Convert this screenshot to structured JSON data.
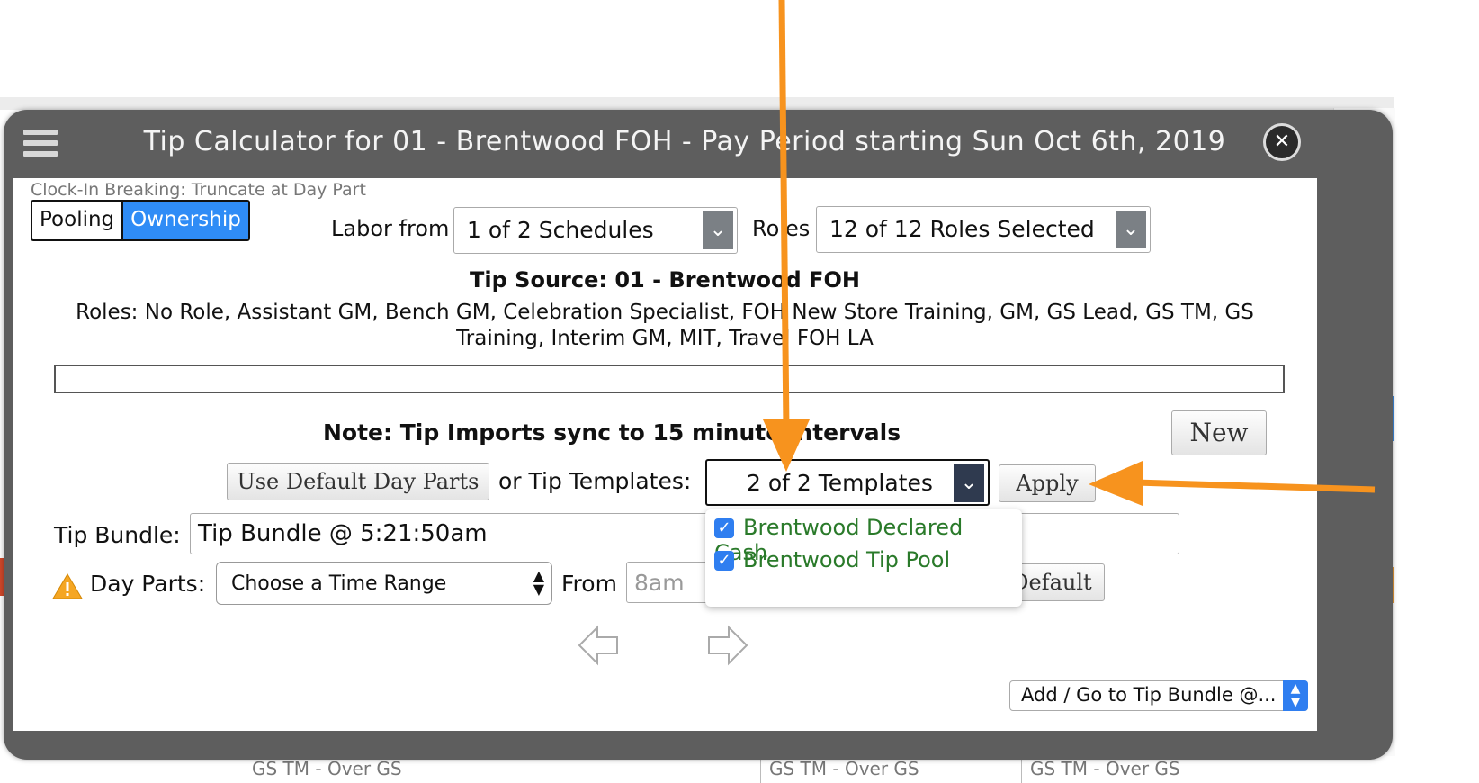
{
  "dialog": {
    "title": "Tip Calculator for 01 - Brentwood FOH - Pay Period starting Sun Oct 6th, 2019",
    "menu_icon": "hamburger-menu-icon",
    "close_icon": "close-circle-icon",
    "clock_in": "Clock-In Breaking: Truncate at Day Part",
    "toggle": {
      "pooling": "Pooling",
      "ownership": "Ownership",
      "active": "Ownership"
    },
    "labor_from_label": "Labor from",
    "labor_from_value": "1 of 2 Schedules",
    "roles_label": "Roles",
    "roles_value": "12 of 12 Roles Selected",
    "tip_source": "Tip Source: 01 - Brentwood FOH",
    "roles_list_1": "Roles: No Role, Assistant GM, Bench GM, Celebration Specialist, FOH New Store Training, GM, GS Lead, GS TM, GS",
    "roles_list_2": "Training, Interim GM, MIT, Travel FOH LA",
    "note": "Note: Tip Imports sync to 15 minute intervals",
    "new_button": "New",
    "use_default_button": "Use Default Day Parts",
    "or_templates_label": "or Tip Templates:",
    "templates_value": "2 of 2 Templates",
    "apply_button": "Apply",
    "templates_options": [
      {
        "label": "Brentwood Declared Cash",
        "checked": true
      },
      {
        "label": "Brentwood Tip Pool",
        "checked": true
      }
    ],
    "tip_bundle_label": "Tip Bundle:",
    "tip_bundle_value": "Tip Bundle @ 5:21:50am",
    "day_parts_label": "Day Parts:",
    "day_parts_value": "Choose a Time Range",
    "from_label": "From",
    "from_placeholder": "8am",
    "default_button": "Default",
    "prev_icon": "arrow-left-icon",
    "next_icon": "arrow-right-icon",
    "warning_icon": "warning-triangle-icon",
    "add_go_select": "Add / Go to Tip Bundle @..."
  },
  "background": {
    "cells": [
      "GS TM - Over GS",
      "GS TM - Over GS",
      "GS TM - Over GS"
    ]
  },
  "colors": {
    "accent": "#2f8cf6",
    "annotation": "#f7931e",
    "titlebar": "#5e5e5e",
    "option_text": "#2a7a2a"
  }
}
